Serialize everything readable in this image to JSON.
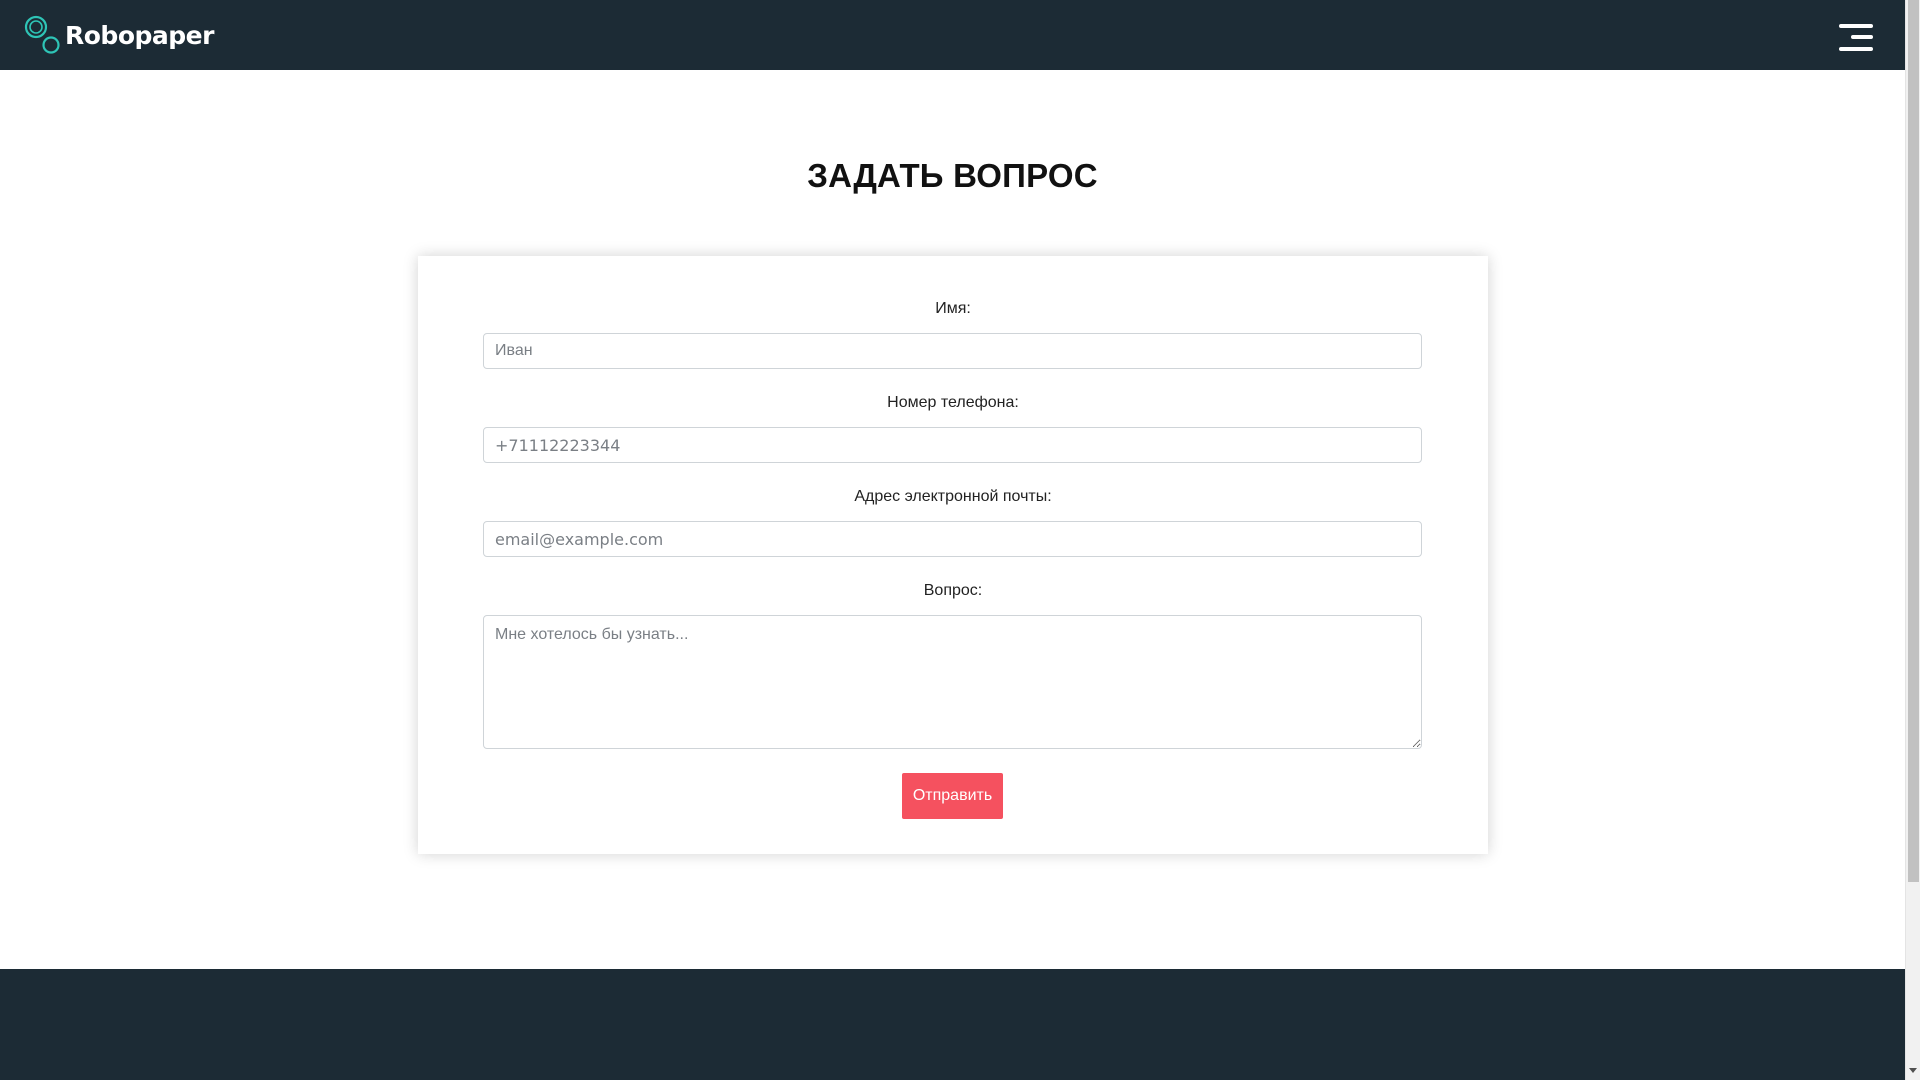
{
  "header": {
    "brand": "Robopaper",
    "logo_icon": "robopaper-logo-icon",
    "menu_icon": "hamburger-menu-icon"
  },
  "main": {
    "title": "ЗАДАТЬ ВОПРОС",
    "form": {
      "name_label": "Имя:",
      "name_placeholder": "Иван",
      "phone_label": "Номер телефона:",
      "phone_placeholder": "+71112223344",
      "email_label": "Адрес электронной почты:",
      "email_placeholder": "email@example.com",
      "question_label": "Вопрос:",
      "question_placeholder": "Мне хотелось бы узнать...",
      "submit_label": "Отправить"
    }
  },
  "colors": {
    "header_bg": "#1c2b35",
    "footer_bg": "#1c2b35",
    "accent": "#f5515f",
    "logo_accent": "#2ec4b6"
  }
}
